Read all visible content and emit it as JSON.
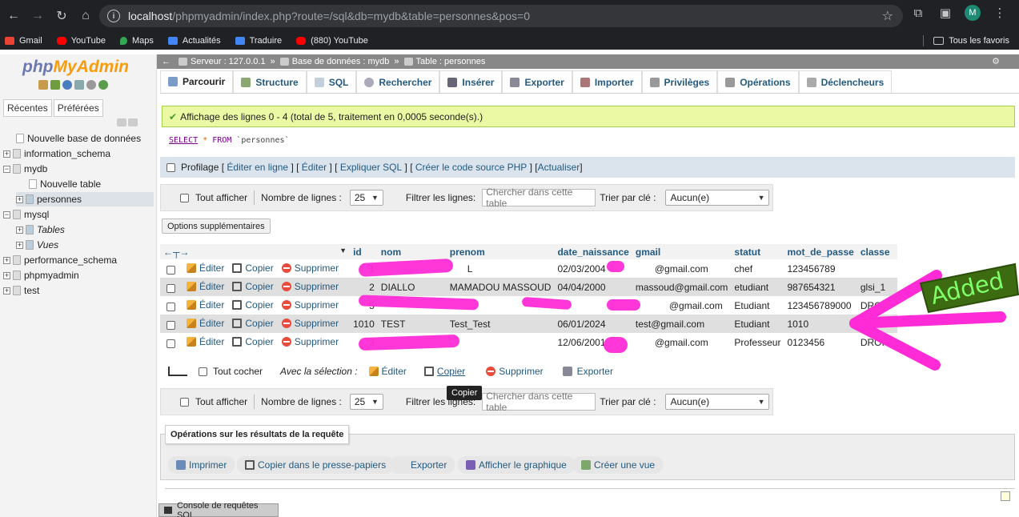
{
  "browser": {
    "url_host": "localhost",
    "url_rest": "/phpmyadmin/index.php?route=/sql&db=mydb&table=personnes&pos=0",
    "avatar_letter": "M",
    "bookmarks": [
      {
        "label": "Gmail",
        "color": "#ea4335"
      },
      {
        "label": "YouTube",
        "color": "#ff0000"
      },
      {
        "label": "Maps",
        "color": "#34a853"
      },
      {
        "label": "Actualités",
        "color": "#4285f4"
      },
      {
        "label": "Traduire",
        "color": "#4285f4"
      },
      {
        "label": "(880) YouTube",
        "color": "#ff0000"
      }
    ],
    "favorites": "Tous les favoris"
  },
  "sidebar": {
    "logo_php": "php",
    "logo_admin": "MyAdmin",
    "tabs": [
      "Récentes",
      "Préférées"
    ],
    "tree": [
      {
        "label": "Nouvelle base de données",
        "level": 0,
        "expander": ""
      },
      {
        "label": "information_schema",
        "level": 0,
        "expander": "+"
      },
      {
        "label": "mydb",
        "level": 0,
        "expander": "−"
      },
      {
        "label": "Nouvelle table",
        "level": 1,
        "expander": ""
      },
      {
        "label": "personnes",
        "level": 1,
        "expander": "+"
      },
      {
        "label": "mysql",
        "level": 0,
        "expander": "−"
      },
      {
        "label": "Tables",
        "level": 1,
        "expander": "+"
      },
      {
        "label": "Vues",
        "level": 1,
        "expander": "+"
      },
      {
        "label": "performance_schema",
        "level": 0,
        "expander": "+"
      },
      {
        "label": "phpmyadmin",
        "level": 0,
        "expander": "+"
      },
      {
        "label": "test",
        "level": 0,
        "expander": "+"
      }
    ]
  },
  "breadcrumb": {
    "server": "Serveur : 127.0.0.1",
    "database": "Base de données : mydb",
    "table": "Table : personnes"
  },
  "tabs": [
    "Parcourir",
    "Structure",
    "SQL",
    "Rechercher",
    "Insérer",
    "Exporter",
    "Importer",
    "Privilèges",
    "Opérations",
    "Déclencheurs"
  ],
  "success_message": "Affichage des lignes 0 - 4 (total de 5, traitement en 0,0005 seconde(s).)",
  "sql": {
    "select": "SELECT",
    "star": " * ",
    "from": "FROM",
    "table": " `personnes`"
  },
  "profiling": {
    "label": "Profilage",
    "links": [
      "Éditer en ligne",
      "Éditer",
      "Expliquer SQL",
      "Créer le code source PHP",
      "Actualiser"
    ]
  },
  "navigation": {
    "show_all": "Tout afficher",
    "rows_label": "Nombre de lignes :",
    "rows_value": "25",
    "filter_label": "Filtrer les lignes:",
    "filter_placeholder": "Chercher dans cette table",
    "sort_label": "Trier par clé :",
    "sort_value": "Aucun(e)"
  },
  "extra_options": "Options supplémentaires",
  "table": {
    "columns": [
      "id",
      "nom",
      "prenom",
      "date_naissance",
      "gmail",
      "statut",
      "mot_de_passe",
      "classe"
    ],
    "actions": {
      "edit": "Éditer",
      "copy": "Copier",
      "delete": "Supprimer"
    },
    "rows": [
      {
        "id": "1",
        "nom": "",
        "prenom": "L",
        "date_naissance": "02/03/2004",
        "gmail": "@gmail.com",
        "statut": "chef",
        "mot_de_passe": "123456789",
        "classe": ""
      },
      {
        "id": "2",
        "nom": "DIALLO",
        "prenom": "MAMADOU MASSOUD",
        "date_naissance": "04/04/2000",
        "gmail": "massoud@gmail.com",
        "statut": "etudiant",
        "mot_de_passe": "987654321",
        "classe": "glsi_1"
      },
      {
        "id": "5",
        "nom": "",
        "prenom": "",
        "date_naissance": "",
        "gmail": "@gmail.com",
        "statut": "Etudiant",
        "mot_de_passe": "123456789000",
        "classe": "DROIT"
      },
      {
        "id": "1010",
        "nom": "TEST",
        "prenom": "Test_Test",
        "date_naissance": "06/01/2024",
        "gmail": "test@gmail.com",
        "statut": "Etudiant",
        "mot_de_passe": "1010",
        "classe": "GLSI"
      },
      {
        "id": "3",
        "nom": "",
        "prenom": "",
        "date_naissance": "12/06/2001",
        "gmail": "@gmail.com",
        "statut": "Professeur",
        "mot_de_passe": "0123456",
        "classe": "DROIT"
      }
    ]
  },
  "selection": {
    "check_all": "Tout cocher",
    "with_selection": "Avec la sélection :",
    "edit": "Éditer",
    "copy": "Copier",
    "delete": "Supprimer",
    "export": "Exporter",
    "tooltip": "Copier"
  },
  "operations": {
    "title": "Opérations sur les résultats de la requête",
    "buttons": [
      "Imprimer",
      "Copier dans le presse-papiers",
      "Exporter",
      "Afficher le graphique",
      "Créer une vue"
    ]
  },
  "console": "Console de requêtes SQL",
  "annotation": {
    "text": "Added",
    "color": "#ff2bd6"
  }
}
